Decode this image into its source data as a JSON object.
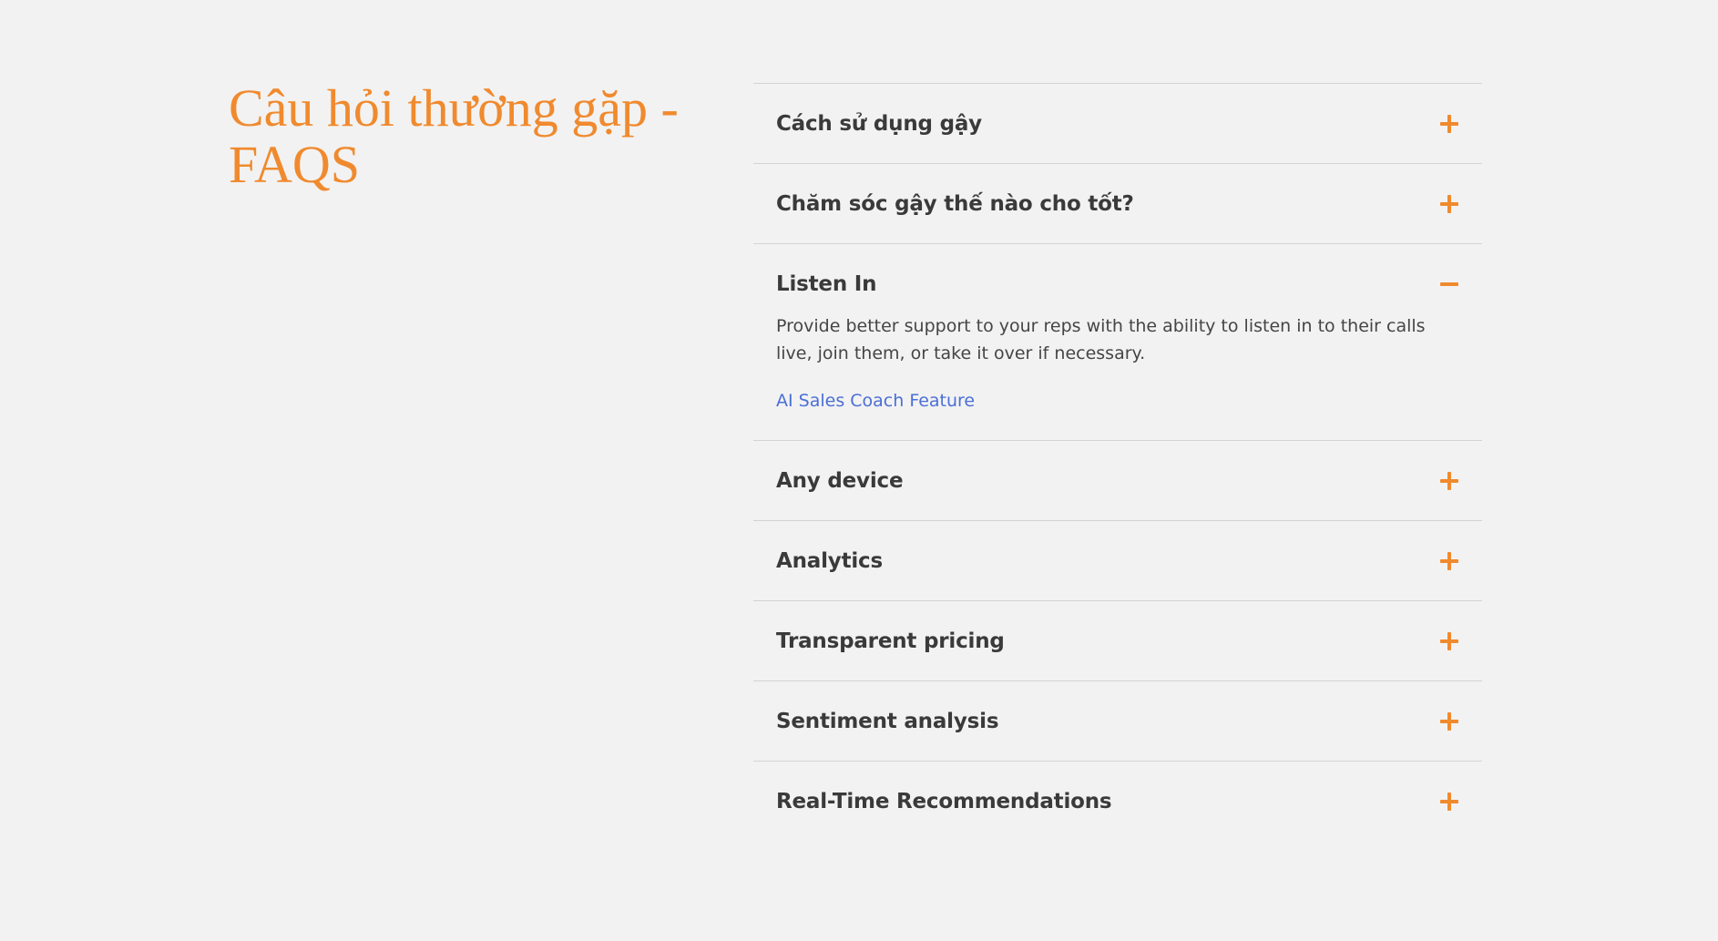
{
  "faq": {
    "title": "Câu hỏi thường gặp - FAQS",
    "accent_color": "#f08a2e",
    "link_color": "#4b6fd6",
    "items": [
      {
        "title": "Cách sử dụng gậy",
        "expanded": false,
        "icon": "plus-icon"
      },
      {
        "title": "Chăm sóc gậy thế nào cho tốt?",
        "expanded": false,
        "icon": "plus-icon"
      },
      {
        "title": "Listen In",
        "expanded": true,
        "icon": "minus-icon",
        "body": "Provide better support to your reps with the ability to listen in to their calls live, join them, or take it over if necessary.",
        "link": "AI Sales Coach Feature"
      },
      {
        "title": "Any device",
        "expanded": false,
        "icon": "plus-icon"
      },
      {
        "title": "Analytics",
        "expanded": false,
        "icon": "plus-icon"
      },
      {
        "title": "Transparent pricing",
        "expanded": false,
        "icon": "plus-icon"
      },
      {
        "title": "Sentiment analysis",
        "expanded": false,
        "icon": "plus-icon"
      },
      {
        "title": "Real-Time Recommendations",
        "expanded": false,
        "icon": "plus-icon"
      }
    ]
  }
}
